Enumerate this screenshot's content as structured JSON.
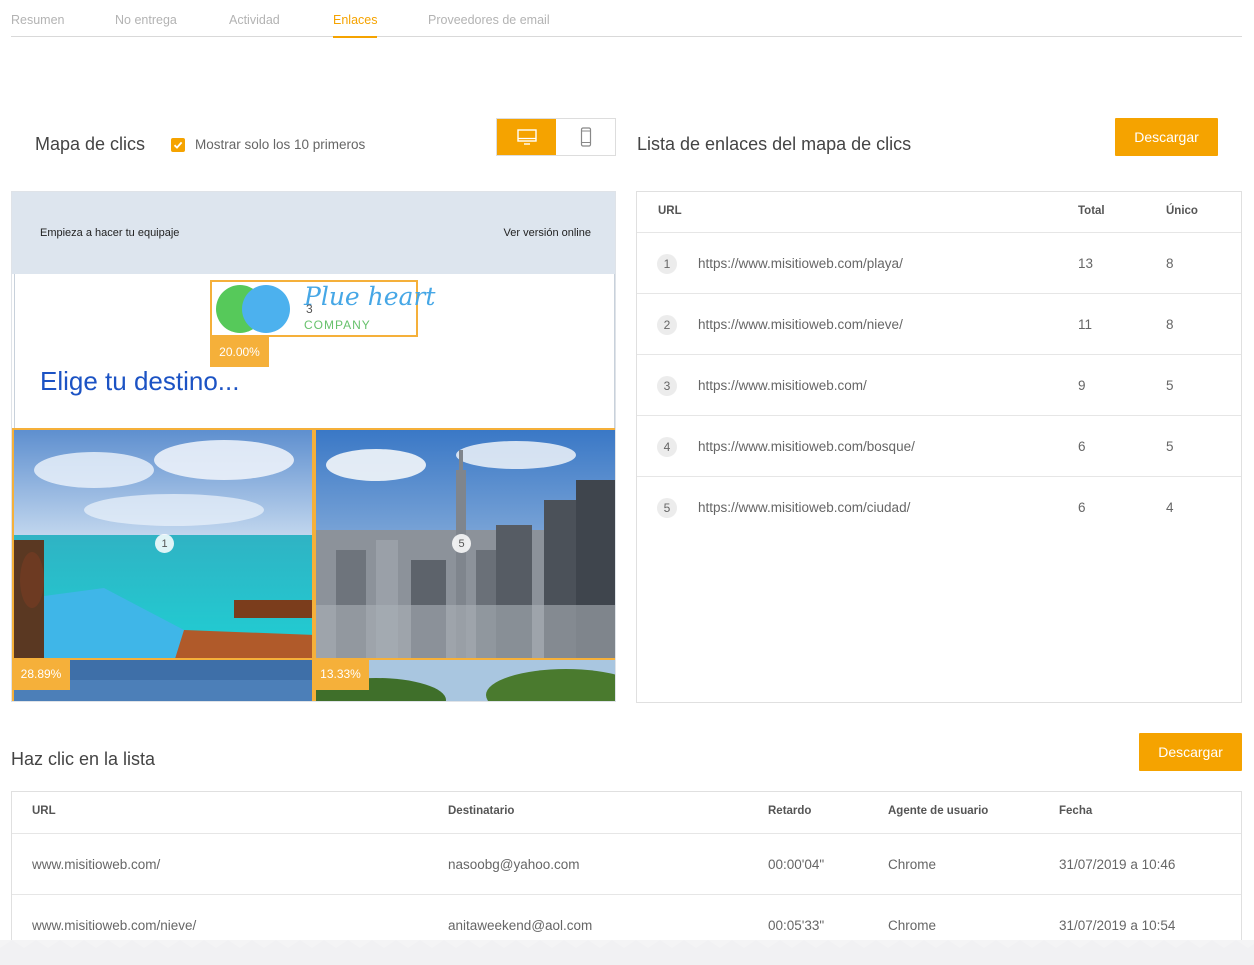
{
  "tabs": [
    {
      "label": "Resumen",
      "active": false
    },
    {
      "label": "No entrega",
      "active": false
    },
    {
      "label": "Actividad",
      "active": false
    },
    {
      "label": "Enlaces",
      "active": true
    },
    {
      "label": "Proveedores de email",
      "active": false
    }
  ],
  "heatmap": {
    "title": "Mapa de clics",
    "checkbox_label": "Mostrar solo los 10 primeros",
    "checkbox_checked": true,
    "device_selected": "desktop",
    "preview": {
      "header_left": "Empieza a hacer tu equipaje",
      "header_right": "Ver versión online",
      "logo_brand": "Plue heart",
      "logo_sub": "COMPANY",
      "logo_marker": "3",
      "logo_pct": "20.00%",
      "headline": "Elige tu destino...",
      "beach_marker": "1",
      "city_marker": "5",
      "beach_pct": "28.89%",
      "city_pct": "13.33%"
    }
  },
  "link_list": {
    "title": "Lista de enlaces del mapa de clics",
    "download_label": "Descargar",
    "headers": {
      "url": "URL",
      "total": "Total",
      "unique": "Único"
    },
    "rows": [
      {
        "idx": "1",
        "url": "https://www.misitioweb.com/playa/",
        "total": "13",
        "unique": "8"
      },
      {
        "idx": "2",
        "url": "https://www.misitioweb.com/nieve/",
        "total": "11",
        "unique": "8"
      },
      {
        "idx": "3",
        "url": "https://www.misitioweb.com/",
        "total": "9",
        "unique": "5"
      },
      {
        "idx": "4",
        "url": "https://www.misitioweb.com/bosque/",
        "total": "6",
        "unique": "5"
      },
      {
        "idx": "5",
        "url": "https://www.misitioweb.com/ciudad/",
        "total": "6",
        "unique": "4"
      }
    ]
  },
  "click_list": {
    "title": "Haz clic en la lista",
    "download_label": "Descargar",
    "headers": {
      "url": "URL",
      "recipient": "Destinatario",
      "delay": "Retardo",
      "agent": "Agente de usuario",
      "date": "Fecha"
    },
    "rows": [
      {
        "url": "www.misitioweb.com/",
        "recipient": "nasoobg@yahoo.com",
        "delay": "00:00'04\"",
        "agent": "Chrome",
        "date": "31/07/2019 a 10:46"
      },
      {
        "url": "www.misitioweb.com/nieve/",
        "recipient": "anitaweekend@aol.com",
        "delay": "00:05'33\"",
        "agent": "Chrome",
        "date": "31/07/2019 a 10:54"
      }
    ]
  },
  "colors": {
    "accent": "#f5a300",
    "headline": "#1c53c4"
  }
}
